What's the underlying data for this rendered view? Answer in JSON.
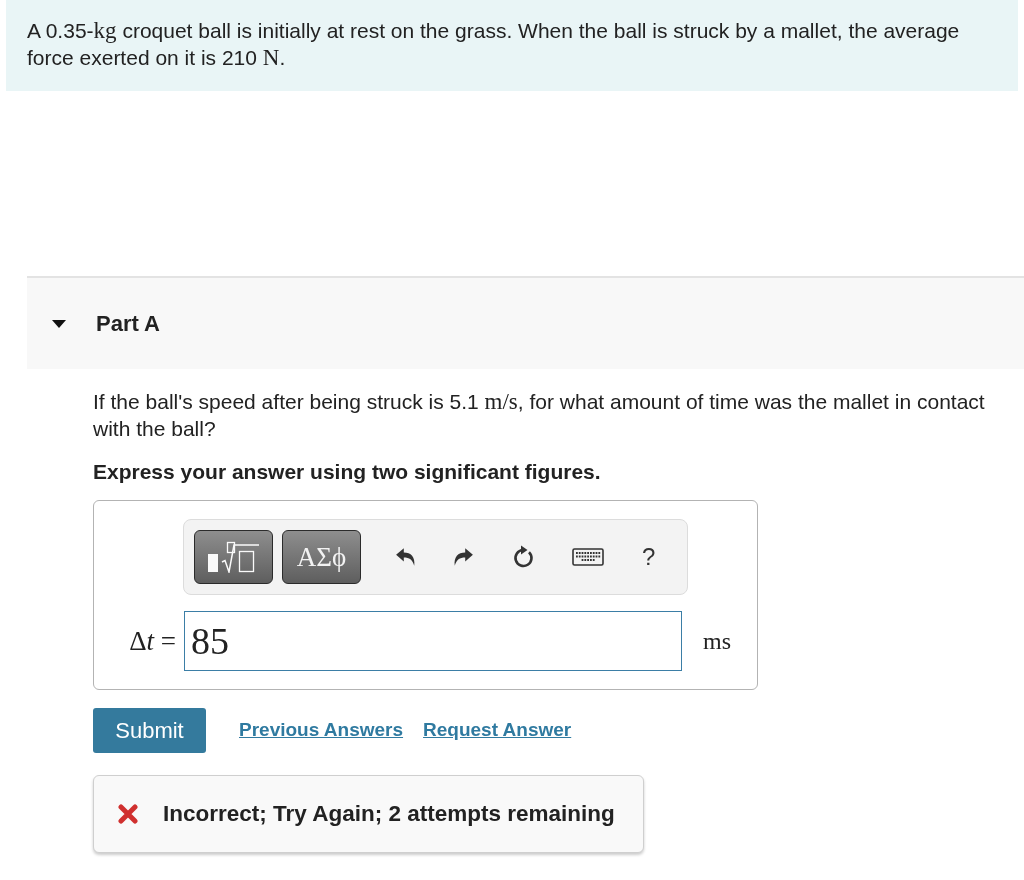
{
  "problem": {
    "text": [
      {
        "kind": "text",
        "text": "A 0.35-"
      },
      {
        "kind": "math",
        "text": "kg"
      },
      {
        "kind": "text",
        "text": " croquet ball is initially at rest on the grass. When the ball is struck by a mallet, the average force exerted on it is 210 "
      },
      {
        "kind": "math",
        "text": "N"
      },
      {
        "kind": "text",
        "text": "."
      }
    ]
  },
  "part": {
    "title": "Part A",
    "expanded": true
  },
  "question": {
    "text": [
      {
        "kind": "text",
        "text": "If the ball's speed after being struck is 5.1 "
      },
      {
        "kind": "math",
        "text": "m/s"
      },
      {
        "kind": "text",
        "text": ", for what amount of time was the mallet in contact with the ball?"
      }
    ],
    "instruction": "Express your answer using two significant figures."
  },
  "answer": {
    "toolbar": {
      "symbols_label": "ΑΣϕ",
      "help_label": "?"
    },
    "label": [
      {
        "kind": "math",
        "text": "Δ"
      },
      {
        "kind": "var",
        "text": "t"
      },
      {
        "kind": "math",
        "text": " ="
      }
    ],
    "value": "85",
    "unit": "ms"
  },
  "actions": {
    "submit": "Submit",
    "links": [
      "Previous Answers",
      "Request Answer"
    ]
  },
  "feedback": {
    "correct": false,
    "text": "Incorrect; Try Again; 2 attempts remaining"
  }
}
